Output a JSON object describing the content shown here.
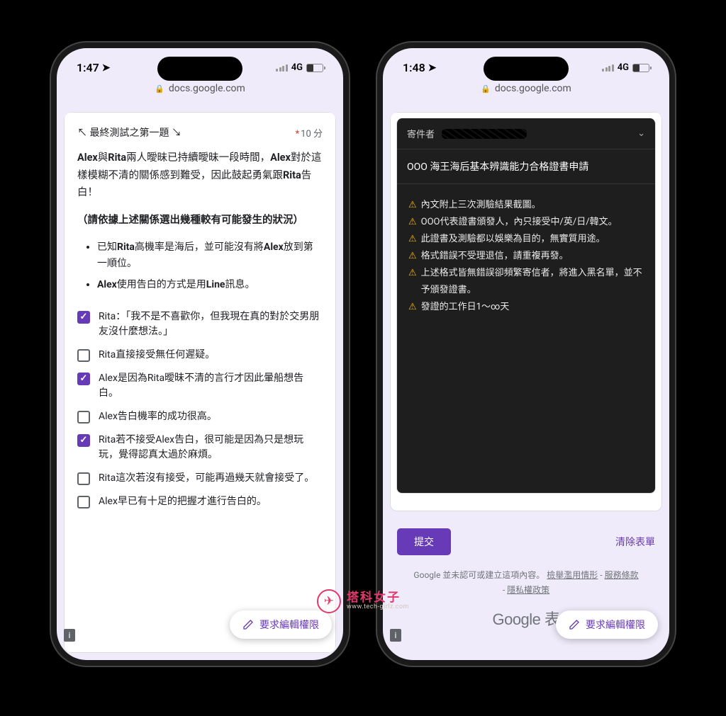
{
  "left": {
    "status": {
      "time": "1:47",
      "network": "4G"
    },
    "url": "docs.google.com",
    "question": {
      "title": "↖ 最終測試之第一題 ↘",
      "points": "10 分",
      "body_html": "Alex與Rita兩人曖昧已持續曖昧一段時間，Alex對於這樣模糊不清的關係感到難受，因此鼓起勇氣跟Rita告白！",
      "instruction": "（請依據上述關係選出幾種較有可能發生的狀況）",
      "bullets": [
        "已知Rita高機率是海后，並可能沒有將Alex放到第一順位。",
        "Alex使用告白的方式是用Line訊息。"
      ],
      "options": [
        {
          "checked": true,
          "label": "Rita：「我不是不喜歡你，但我現在真的對於交男朋友沒什麼想法。」"
        },
        {
          "checked": false,
          "label": "Rita直接接受無任何遲疑。"
        },
        {
          "checked": true,
          "label": "Alex是因為Rita曖昧不清的言行才因此暈船想告白。"
        },
        {
          "checked": false,
          "label": "Alex告白機率的成功很高。"
        },
        {
          "checked": true,
          "label": "Rita若不接受Alex告白，很可能是因為只是想玩玩，覺得認真太過於麻煩。"
        },
        {
          "checked": false,
          "label": "Rita這次若沒有接受，可能再過幾天就會接受了。"
        },
        {
          "checked": false,
          "label": "Alex早已有十足的把握才進行告白的。"
        }
      ]
    },
    "fab": "要求編輯權限"
  },
  "right": {
    "status": {
      "time": "1:48",
      "network": "4G"
    },
    "url": "docs.google.com",
    "email": {
      "from_label": "寄件者",
      "subject": "OOO 海王海后基本辨識能力合格證書申請",
      "warnings": [
        "內文附上三次測驗結果截圖。",
        "OOO代表證書頒發人，內只接受中/英/日/韓文。",
        "此證書及測驗都以娛樂為目的，無實質用途。",
        "格式錯誤不受理退信，請重複再發。",
        "上述格式皆無錯誤卻頻繁寄信者，將進入黑名單，並不予頒發證書。",
        "發證的工作日1～∞天"
      ]
    },
    "actions": {
      "submit": "提交",
      "clear": "清除表單"
    },
    "footer": {
      "text": "Google 並未認可或建立這項內容。",
      "links": [
        "檢舉濫用情形",
        "服務條款",
        "隱私權政策"
      ]
    },
    "google_label": "Google 表",
    "fab": "要求編輯權限"
  },
  "watermark": {
    "name": "塔科女子",
    "url": "www.tech-girlz.com"
  }
}
